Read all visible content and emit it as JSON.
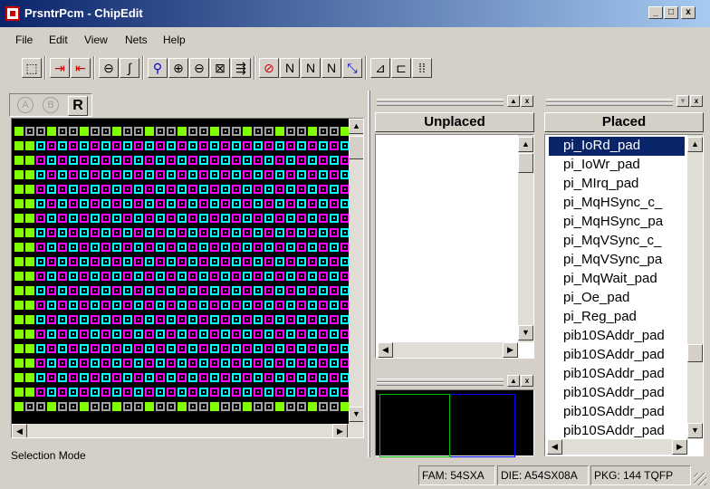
{
  "window": {
    "app_title": "PrsntrPcm - ChipEdit",
    "minimize": "_",
    "maximize": "□",
    "close": "x"
  },
  "menu": [
    "File",
    "Edit",
    "View",
    "Nets",
    "Help"
  ],
  "toolbar": [
    {
      "name": "database-icon",
      "glyph": "⬚",
      "style": "",
      "group": 0
    },
    {
      "name": "import-icon",
      "glyph": "⇥",
      "style": "red",
      "group": 1
    },
    {
      "name": "export-icon",
      "glyph": "⇤",
      "style": "red",
      "group": 1
    },
    {
      "name": "lock-icon",
      "glyph": "⊖",
      "style": "",
      "group": 2
    },
    {
      "name": "unlock-icon",
      "glyph": "∫",
      "style": "",
      "group": 2
    },
    {
      "name": "select-zoom-icon",
      "glyph": "⚲",
      "style": "blue",
      "group": 3
    },
    {
      "name": "zoom-in-icon",
      "glyph": "⊕",
      "style": "",
      "group": 3
    },
    {
      "name": "zoom-out-icon",
      "glyph": "⊖",
      "style": "",
      "group": 3
    },
    {
      "name": "zoom-fit-icon",
      "glyph": "⊠",
      "style": "",
      "group": 3
    },
    {
      "name": "place-icon",
      "glyph": "⇶",
      "style": "",
      "group": 3
    },
    {
      "name": "no-net-icon",
      "glyph": "⊘",
      "style": "red",
      "group": 4
    },
    {
      "name": "net-in-icon",
      "glyph": "N",
      "style": "",
      "group": 4
    },
    {
      "name": "net-out-icon",
      "glyph": "N",
      "style": "",
      "group": 4
    },
    {
      "name": "net-both-icon",
      "glyph": "N",
      "style": "",
      "group": 4
    },
    {
      "name": "net-ratsnest-icon",
      "glyph": "⤡",
      "style": "blue",
      "group": 4
    },
    {
      "name": "route-icon",
      "glyph": "⊿",
      "style": "",
      "group": 5
    },
    {
      "name": "pin-icon",
      "glyph": "⊏",
      "style": "",
      "group": 5
    },
    {
      "name": "grid-dots-icon",
      "glyph": "⁞⁞",
      "style": "",
      "group": 5
    }
  ],
  "view_tabs": {
    "a": "A",
    "b": "B",
    "r": "R"
  },
  "panels": {
    "unplaced_title": "Unplaced",
    "placed_title": "Placed"
  },
  "placed_items": [
    "pi_IoRd_pad",
    "pi_IoWr_pad",
    "pi_MIrq_pad",
    "pi_MqHSync_c_",
    "pi_MqHSync_pa",
    "pi_MqVSync_c_",
    "pi_MqVSync_pa",
    "pi_MqWait_pad",
    "pi_Oe_pad",
    "pi_Reg_pad",
    "pib10SAddr_pad",
    "pib10SAddr_pad",
    "pib10SAddr_pad",
    "pib10SAddr_pad",
    "pib10SAddr_pad",
    "pib10SAddr_pad",
    "pib10SAddr_pad"
  ],
  "selected_index": 0,
  "status": {
    "mode": "Selection Mode",
    "fam": "FAM: 54SXA",
    "die": "DIE: A54SX08A",
    "pkg": "PKG: 144 TQFP"
  },
  "colors": {
    "magenta": "#ff00ff",
    "cyan": "#00ffff",
    "green": "#80ff00",
    "yellow": "#ffff00",
    "grey": "#a0a0a0"
  }
}
